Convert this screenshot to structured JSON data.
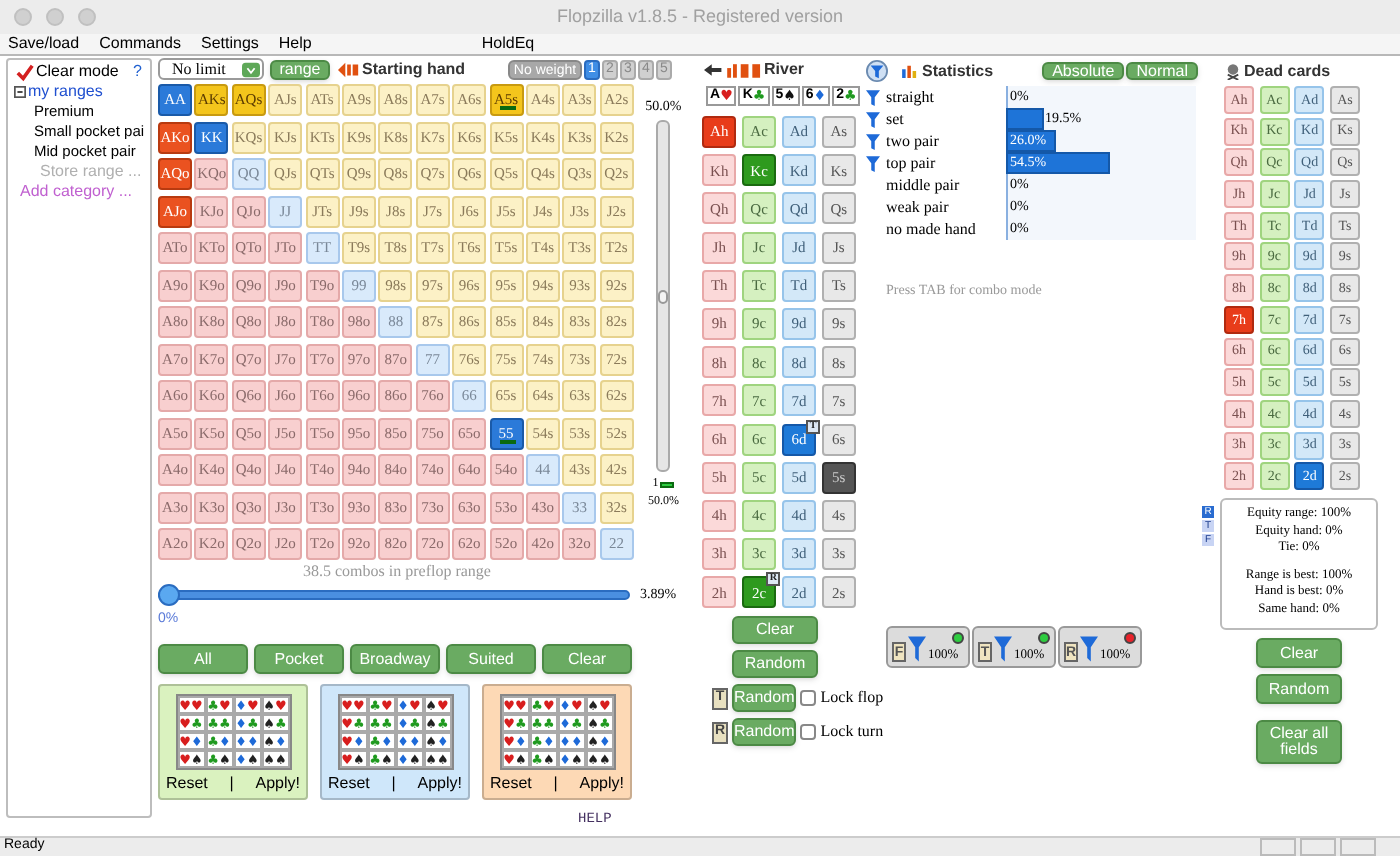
{
  "window": {
    "title": "Flopzilla v1.8.5 - Registered version"
  },
  "menu": [
    "Save/load",
    "Commands",
    "Settings",
    "Help"
  ],
  "menu_extra": "HoldEq",
  "sidebar": {
    "clear_mode": {
      "label": "Clear mode",
      "checked": true
    },
    "help": "?",
    "tree": [
      {
        "label": "my ranges",
        "expanded": true,
        "children": [
          {
            "label": "Premium"
          },
          {
            "label": "Small pocket pai"
          },
          {
            "label": "Mid pocket pair"
          }
        ]
      }
    ],
    "store": "Store range ...",
    "add": "Add category ..."
  },
  "range_toolbar": {
    "game": "No limit",
    "range_button": "range",
    "title": "Starting hand",
    "weight_button": "No weight",
    "weights": [
      {
        "label": "1",
        "selected": true
      },
      {
        "label": "2",
        "selected": false
      },
      {
        "label": "3",
        "selected": false
      },
      {
        "label": "4",
        "selected": false
      },
      {
        "label": "5",
        "selected": false
      }
    ]
  },
  "hands": [
    [
      {
        "label": "AA",
        "selected": true
      },
      {
        "label": "AKs",
        "selected": true
      },
      {
        "label": "AQs",
        "selected": true
      },
      {
        "label": "AJs",
        "selected": false
      },
      {
        "label": "ATs",
        "selected": false
      },
      {
        "label": "A9s",
        "selected": false
      },
      {
        "label": "A8s",
        "selected": false
      },
      {
        "label": "A7s",
        "selected": false
      },
      {
        "label": "A6s",
        "selected": false
      },
      {
        "label": "A5s",
        "selected": true,
        "marked": true
      },
      {
        "label": "A4s",
        "selected": false
      },
      {
        "label": "A3s",
        "selected": false
      },
      {
        "label": "A2s",
        "selected": false
      }
    ],
    [
      {
        "label": "AKo",
        "selected": true
      },
      {
        "label": "KK",
        "selected": true
      },
      {
        "label": "KQs",
        "selected": false
      },
      {
        "label": "KJs",
        "selected": false
      },
      {
        "label": "KTs",
        "selected": false
      },
      {
        "label": "K9s",
        "selected": false
      },
      {
        "label": "K8s",
        "selected": false
      },
      {
        "label": "K7s",
        "selected": false
      },
      {
        "label": "K6s",
        "selected": false
      },
      {
        "label": "K5s",
        "selected": false
      },
      {
        "label": "K4s",
        "selected": false
      },
      {
        "label": "K3s",
        "selected": false
      },
      {
        "label": "K2s",
        "selected": false
      }
    ],
    [
      {
        "label": "AQo",
        "selected": true
      },
      {
        "label": "KQo",
        "selected": false
      },
      {
        "label": "QQ",
        "selected": false
      },
      {
        "label": "QJs",
        "selected": false
      },
      {
        "label": "QTs",
        "selected": false
      },
      {
        "label": "Q9s",
        "selected": false
      },
      {
        "label": "Q8s",
        "selected": false
      },
      {
        "label": "Q7s",
        "selected": false
      },
      {
        "label": "Q6s",
        "selected": false
      },
      {
        "label": "Q5s",
        "selected": false
      },
      {
        "label": "Q4s",
        "selected": false
      },
      {
        "label": "Q3s",
        "selected": false
      },
      {
        "label": "Q2s",
        "selected": false
      }
    ],
    [
      {
        "label": "AJo",
        "selected": true
      },
      {
        "label": "KJo",
        "selected": false
      },
      {
        "label": "QJo",
        "selected": false
      },
      {
        "label": "JJ",
        "selected": false
      },
      {
        "label": "JTs",
        "selected": false
      },
      {
        "label": "J9s",
        "selected": false
      },
      {
        "label": "J8s",
        "selected": false
      },
      {
        "label": "J7s",
        "selected": false
      },
      {
        "label": "J6s",
        "selected": false
      },
      {
        "label": "J5s",
        "selected": false
      },
      {
        "label": "J4s",
        "selected": false
      },
      {
        "label": "J3s",
        "selected": false
      },
      {
        "label": "J2s",
        "selected": false
      }
    ],
    [
      {
        "label": "ATo",
        "selected": false
      },
      {
        "label": "KTo",
        "selected": false
      },
      {
        "label": "QTo",
        "selected": false
      },
      {
        "label": "JTo",
        "selected": false
      },
      {
        "label": "TT",
        "selected": false
      },
      {
        "label": "T9s",
        "selected": false
      },
      {
        "label": "T8s",
        "selected": false
      },
      {
        "label": "T7s",
        "selected": false
      },
      {
        "label": "T6s",
        "selected": false
      },
      {
        "label": "T5s",
        "selected": false
      },
      {
        "label": "T4s",
        "selected": false
      },
      {
        "label": "T3s",
        "selected": false
      },
      {
        "label": "T2s",
        "selected": false
      }
    ],
    [
      {
        "label": "A9o",
        "selected": false
      },
      {
        "label": "K9o",
        "selected": false
      },
      {
        "label": "Q9o",
        "selected": false
      },
      {
        "label": "J9o",
        "selected": false
      },
      {
        "label": "T9o",
        "selected": false
      },
      {
        "label": "99",
        "selected": false
      },
      {
        "label": "98s",
        "selected": false
      },
      {
        "label": "97s",
        "selected": false
      },
      {
        "label": "96s",
        "selected": false
      },
      {
        "label": "95s",
        "selected": false
      },
      {
        "label": "94s",
        "selected": false
      },
      {
        "label": "93s",
        "selected": false
      },
      {
        "label": "92s",
        "selected": false
      }
    ],
    [
      {
        "label": "A8o",
        "selected": false
      },
      {
        "label": "K8o",
        "selected": false
      },
      {
        "label": "Q8o",
        "selected": false
      },
      {
        "label": "J8o",
        "selected": false
      },
      {
        "label": "T8o",
        "selected": false
      },
      {
        "label": "98o",
        "selected": false
      },
      {
        "label": "88",
        "selected": false
      },
      {
        "label": "87s",
        "selected": false
      },
      {
        "label": "86s",
        "selected": false
      },
      {
        "label": "85s",
        "selected": false
      },
      {
        "label": "84s",
        "selected": false
      },
      {
        "label": "83s",
        "selected": false
      },
      {
        "label": "82s",
        "selected": false
      }
    ],
    [
      {
        "label": "A7o",
        "selected": false
      },
      {
        "label": "K7o",
        "selected": false
      },
      {
        "label": "Q7o",
        "selected": false
      },
      {
        "label": "J7o",
        "selected": false
      },
      {
        "label": "T7o",
        "selected": false
      },
      {
        "label": "97o",
        "selected": false
      },
      {
        "label": "87o",
        "selected": false
      },
      {
        "label": "77",
        "selected": false
      },
      {
        "label": "76s",
        "selected": false
      },
      {
        "label": "75s",
        "selected": false
      },
      {
        "label": "74s",
        "selected": false
      },
      {
        "label": "73s",
        "selected": false
      },
      {
        "label": "72s",
        "selected": false
      }
    ],
    [
      {
        "label": "A6o",
        "selected": false
      },
      {
        "label": "K6o",
        "selected": false
      },
      {
        "label": "Q6o",
        "selected": false
      },
      {
        "label": "J6o",
        "selected": false
      },
      {
        "label": "T6o",
        "selected": false
      },
      {
        "label": "96o",
        "selected": false
      },
      {
        "label": "86o",
        "selected": false
      },
      {
        "label": "76o",
        "selected": false
      },
      {
        "label": "66",
        "selected": false
      },
      {
        "label": "65s",
        "selected": false
      },
      {
        "label": "64s",
        "selected": false
      },
      {
        "label": "63s",
        "selected": false
      },
      {
        "label": "62s",
        "selected": false
      }
    ],
    [
      {
        "label": "A5o",
        "selected": false
      },
      {
        "label": "K5o",
        "selected": false
      },
      {
        "label": "Q5o",
        "selected": false
      },
      {
        "label": "J5o",
        "selected": false
      },
      {
        "label": "T5o",
        "selected": false
      },
      {
        "label": "95o",
        "selected": false
      },
      {
        "label": "85o",
        "selected": false
      },
      {
        "label": "75o",
        "selected": false
      },
      {
        "label": "65o",
        "selected": false
      },
      {
        "label": "55",
        "selected": true,
        "marked": true
      },
      {
        "label": "54s",
        "selected": false
      },
      {
        "label": "53s",
        "selected": false
      },
      {
        "label": "52s",
        "selected": false
      }
    ],
    [
      {
        "label": "A4o",
        "selected": false
      },
      {
        "label": "K4o",
        "selected": false
      },
      {
        "label": "Q4o",
        "selected": false
      },
      {
        "label": "J4o",
        "selected": false
      },
      {
        "label": "T4o",
        "selected": false
      },
      {
        "label": "94o",
        "selected": false
      },
      {
        "label": "84o",
        "selected": false
      },
      {
        "label": "74o",
        "selected": false
      },
      {
        "label": "64o",
        "selected": false
      },
      {
        "label": "54o",
        "selected": false
      },
      {
        "label": "44",
        "selected": false
      },
      {
        "label": "43s",
        "selected": false
      },
      {
        "label": "42s",
        "selected": false
      }
    ],
    [
      {
        "label": "A3o",
        "selected": false
      },
      {
        "label": "K3o",
        "selected": false
      },
      {
        "label": "Q3o",
        "selected": false
      },
      {
        "label": "J3o",
        "selected": false
      },
      {
        "label": "T3o",
        "selected": false
      },
      {
        "label": "93o",
        "selected": false
      },
      {
        "label": "83o",
        "selected": false
      },
      {
        "label": "73o",
        "selected": false
      },
      {
        "label": "63o",
        "selected": false
      },
      {
        "label": "53o",
        "selected": false
      },
      {
        "label": "43o",
        "selected": false
      },
      {
        "label": "33",
        "selected": false
      },
      {
        "label": "32s",
        "selected": false
      }
    ],
    [
      {
        "label": "A2o",
        "selected": false
      },
      {
        "label": "K2o",
        "selected": false
      },
      {
        "label": "Q2o",
        "selected": false
      },
      {
        "label": "J2o",
        "selected": false
      },
      {
        "label": "T2o",
        "selected": false
      },
      {
        "label": "92o",
        "selected": false
      },
      {
        "label": "82o",
        "selected": false
      },
      {
        "label": "72o",
        "selected": false
      },
      {
        "label": "62o",
        "selected": false
      },
      {
        "label": "52o",
        "selected": false
      },
      {
        "label": "42o",
        "selected": false
      },
      {
        "label": "32o",
        "selected": false
      },
      {
        "label": "22",
        "selected": false
      }
    ]
  ],
  "weight_slider": {
    "level": 0.5,
    "top_reading": "50.0%",
    "bottom_index": "1",
    "bottom_reading": "50.0%"
  },
  "combos_text": "38.5 combos in preflop range",
  "range_slider": {
    "level": 0.0,
    "reading": "3.89%",
    "min_label": "0%"
  },
  "range_buttons": [
    "All",
    "Pocket",
    "Broadway",
    "Suited",
    "Clear"
  ],
  "suit_panels": [
    {
      "color": "#daf2bf",
      "cells": [
        "♥♥",
        "♣♥",
        "♦♥",
        "♠♥",
        "♥♣",
        "♣♣",
        "♦♣",
        "♠♣",
        "♥♦",
        "♣♦",
        "♦♦",
        "♠♦",
        "♥♠",
        "♣♠",
        "♦♠",
        "♠♠"
      ],
      "reset": "Reset",
      "separator": "|",
      "apply": "Apply!"
    },
    {
      "color": "#cfe7fa",
      "cells": [
        "♥♥",
        "♣♥",
        "♦♥",
        "♠♥",
        "♥♣",
        "♣♣",
        "♦♣",
        "♠♣",
        "♥♦",
        "♣♦",
        "♦♦",
        "♠♦",
        "♥♠",
        "♣♠",
        "♦♠",
        "♠♠"
      ],
      "reset": "Reset",
      "separator": "|",
      "apply": "Apply!"
    },
    {
      "color": "#fdd9b5",
      "cells": [
        "♥♥",
        "♣♥",
        "♦♥",
        "♠♥",
        "♥♣",
        "♣♣",
        "♦♣",
        "♠♣",
        "♥♦",
        "♣♦",
        "♦♦",
        "♠♦",
        "♥♠",
        "♣♠",
        "♦♠",
        "♠♠"
      ],
      "reset": "Reset",
      "separator": "|",
      "apply": "Apply!"
    }
  ],
  "help": "HELP",
  "board": {
    "title": "River",
    "display": [
      {
        "rank": "A",
        "suit": "♥",
        "color": "#d81e1e"
      },
      {
        "rank": "K",
        "suit": "♣",
        "color": "#1f9a1f"
      },
      {
        "rank": "5",
        "suit": "♠",
        "color": "#111111"
      },
      {
        "rank": "6",
        "suit": "♦",
        "color": "#1e6ad8"
      },
      {
        "rank": "2",
        "suit": "♣",
        "color": "#1f9a1f"
      }
    ],
    "cards": [
      [
        {
          "label": "Ah",
          "selected": true
        },
        {
          "label": "Ac",
          "selected": false
        },
        {
          "label": "Ad",
          "selected": false
        },
        {
          "label": "As",
          "selected": false
        }
      ],
      [
        {
          "label": "Kh",
          "selected": false
        },
        {
          "label": "Kc",
          "selected": true
        },
        {
          "label": "Kd",
          "selected": false
        },
        {
          "label": "Ks",
          "selected": false
        }
      ],
      [
        {
          "label": "Qh",
          "selected": false
        },
        {
          "label": "Qc",
          "selected": false
        },
        {
          "label": "Qd",
          "selected": false
        },
        {
          "label": "Qs",
          "selected": false
        }
      ],
      [
        {
          "label": "Jh",
          "selected": false
        },
        {
          "label": "Jc",
          "selected": false
        },
        {
          "label": "Jd",
          "selected": false
        },
        {
          "label": "Js",
          "selected": false
        }
      ],
      [
        {
          "label": "Th",
          "selected": false
        },
        {
          "label": "Tc",
          "selected": false
        },
        {
          "label": "Td",
          "selected": false
        },
        {
          "label": "Ts",
          "selected": false
        }
      ],
      [
        {
          "label": "9h",
          "selected": false
        },
        {
          "label": "9c",
          "selected": false
        },
        {
          "label": "9d",
          "selected": false
        },
        {
          "label": "9s",
          "selected": false
        }
      ],
      [
        {
          "label": "8h",
          "selected": false
        },
        {
          "label": "8c",
          "selected": false
        },
        {
          "label": "8d",
          "selected": false
        },
        {
          "label": "8s",
          "selected": false
        }
      ],
      [
        {
          "label": "7h",
          "selected": false
        },
        {
          "label": "7c",
          "selected": false
        },
        {
          "label": "7d",
          "selected": false
        },
        {
          "label": "7s",
          "selected": false
        }
      ],
      [
        {
          "label": "6h",
          "selected": false
        },
        {
          "label": "6c",
          "selected": false
        },
        {
          "label": "6d",
          "selected": true,
          "badge": "T"
        },
        {
          "label": "6s",
          "selected": false
        }
      ],
      [
        {
          "label": "5h",
          "selected": false
        },
        {
          "label": "5c",
          "selected": false
        },
        {
          "label": "5d",
          "selected": false
        },
        {
          "label": "5s",
          "selected": true
        }
      ],
      [
        {
          "label": "4h",
          "selected": false
        },
        {
          "label": "4c",
          "selected": false
        },
        {
          "label": "4d",
          "selected": false
        },
        {
          "label": "4s",
          "selected": false
        }
      ],
      [
        {
          "label": "3h",
          "selected": false
        },
        {
          "label": "3c",
          "selected": false
        },
        {
          "label": "3d",
          "selected": false
        },
        {
          "label": "3s",
          "selected": false
        }
      ],
      [
        {
          "label": "2h",
          "selected": false
        },
        {
          "label": "2c",
          "selected": true,
          "badge": "R"
        },
        {
          "label": "2d",
          "selected": false
        },
        {
          "label": "2s",
          "selected": false
        }
      ]
    ],
    "clear": "Clear",
    "random": "Random",
    "locks": [
      {
        "letter": "T",
        "button": "Random",
        "label": "Lock flop",
        "checked": false
      },
      {
        "letter": "R",
        "button": "Random",
        "label": "Lock turn",
        "checked": false
      }
    ]
  },
  "statistics": {
    "title": "Statistics",
    "modes": [
      {
        "label": "Absolute"
      },
      {
        "label": "Normal"
      }
    ],
    "rows": [
      {
        "label": "straight",
        "value": "0%",
        "level": 0,
        "filtered": true
      },
      {
        "label": "set",
        "value": "19.5%",
        "level": 0.195,
        "filtered": true
      },
      {
        "label": "two pair",
        "value": "26.0%",
        "level": 0.26,
        "filtered": true
      },
      {
        "label": "top pair",
        "value": "54.5%",
        "level": 0.545,
        "filtered": true
      },
      {
        "label": "middle pair",
        "value": "0%",
        "level": 0,
        "filtered": false
      },
      {
        "label": "weak pair",
        "value": "0%",
        "level": 0,
        "filtered": false
      },
      {
        "label": "no made hand",
        "value": "0%",
        "level": 0,
        "filtered": false
      }
    ],
    "hint": "Press TAB for combo mode",
    "filters": [
      {
        "letter": "F",
        "value": "100%",
        "active": true
      },
      {
        "letter": "T",
        "value": "100%",
        "active": true
      },
      {
        "letter": "R",
        "value": "100%",
        "active": false
      }
    ]
  },
  "dead_cards": {
    "title": "Dead cards",
    "cards": [
      [
        {
          "label": "Ah",
          "selected": false
        },
        {
          "label": "Ac",
          "selected": false
        },
        {
          "label": "Ad",
          "selected": false
        },
        {
          "label": "As",
          "selected": false
        }
      ],
      [
        {
          "label": "Kh",
          "selected": false
        },
        {
          "label": "Kc",
          "selected": false
        },
        {
          "label": "Kd",
          "selected": false
        },
        {
          "label": "Ks",
          "selected": false
        }
      ],
      [
        {
          "label": "Qh",
          "selected": false
        },
        {
          "label": "Qc",
          "selected": false
        },
        {
          "label": "Qd",
          "selected": false
        },
        {
          "label": "Qs",
          "selected": false
        }
      ],
      [
        {
          "label": "Jh",
          "selected": false
        },
        {
          "label": "Jc",
          "selected": false
        },
        {
          "label": "Jd",
          "selected": false
        },
        {
          "label": "Js",
          "selected": false
        }
      ],
      [
        {
          "label": "Th",
          "selected": false
        },
        {
          "label": "Tc",
          "selected": false
        },
        {
          "label": "Td",
          "selected": false
        },
        {
          "label": "Ts",
          "selected": false
        }
      ],
      [
        {
          "label": "9h",
          "selected": false
        },
        {
          "label": "9c",
          "selected": false
        },
        {
          "label": "9d",
          "selected": false
        },
        {
          "label": "9s",
          "selected": false
        }
      ],
      [
        {
          "label": "8h",
          "selected": false
        },
        {
          "label": "8c",
          "selected": false
        },
        {
          "label": "8d",
          "selected": false
        },
        {
          "label": "8s",
          "selected": false
        }
      ],
      [
        {
          "label": "7h",
          "selected": true
        },
        {
          "label": "7c",
          "selected": false
        },
        {
          "label": "7d",
          "selected": false
        },
        {
          "label": "7s",
          "selected": false
        }
      ],
      [
        {
          "label": "6h",
          "selected": false
        },
        {
          "label": "6c",
          "selected": false
        },
        {
          "label": "6d",
          "selected": false
        },
        {
          "label": "6s",
          "selected": false
        }
      ],
      [
        {
          "label": "5h",
          "selected": false
        },
        {
          "label": "5c",
          "selected": false
        },
        {
          "label": "5d",
          "selected": false
        },
        {
          "label": "5s",
          "selected": false
        }
      ],
      [
        {
          "label": "4h",
          "selected": false
        },
        {
          "label": "4c",
          "selected": false
        },
        {
          "label": "4d",
          "selected": false
        },
        {
          "label": "4s",
          "selected": false
        }
      ],
      [
        {
          "label": "3h",
          "selected": false
        },
        {
          "label": "3c",
          "selected": false
        },
        {
          "label": "3d",
          "selected": false
        },
        {
          "label": "3s",
          "selected": false
        }
      ],
      [
        {
          "label": "2h",
          "selected": false
        },
        {
          "label": "2c",
          "selected": false
        },
        {
          "label": "2d",
          "selected": true
        },
        {
          "label": "2s",
          "selected": false
        }
      ]
    ],
    "street_tabs": [
      {
        "letter": "R",
        "selected": true
      },
      {
        "letter": "T",
        "selected": false
      },
      {
        "letter": "F",
        "selected": false
      }
    ],
    "equity": [
      [
        "Equity range: 100%",
        "Equity hand: 0%",
        "Tie: 0%"
      ],
      [
        "Range is best: 100%",
        "Hand is best: 0%",
        "Same hand: 0%"
      ]
    ],
    "clear": "Clear",
    "random": "Random",
    "clear_all": "Clear all fields"
  },
  "status_bar": {
    "text": "Ready"
  }
}
